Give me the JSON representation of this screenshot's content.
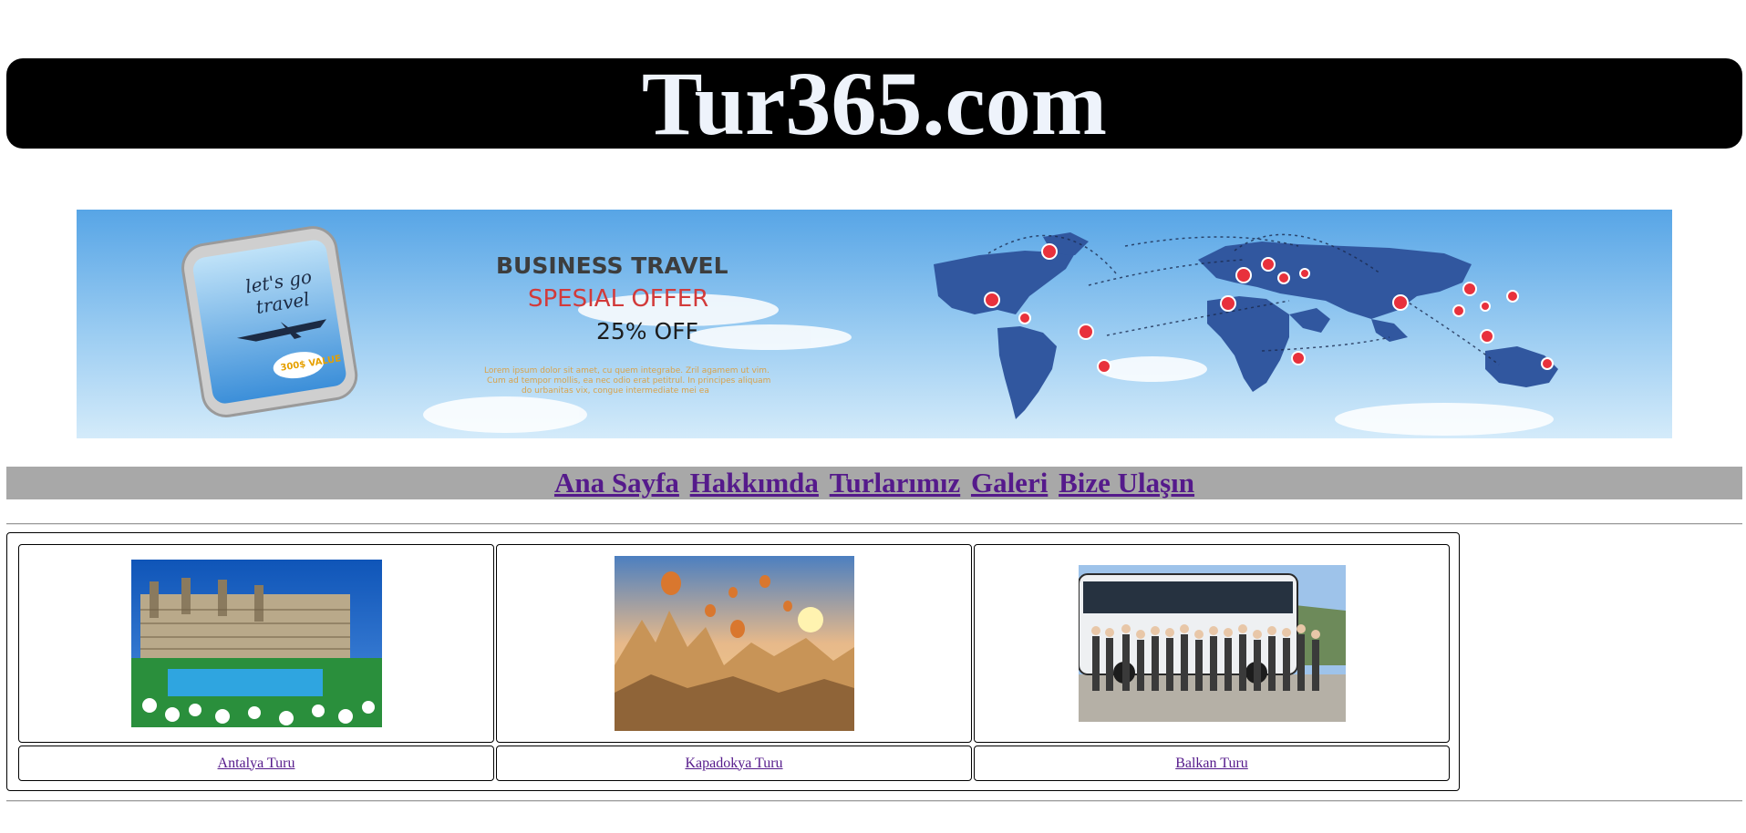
{
  "site": {
    "title": "Tur365.com"
  },
  "banner": {
    "phone_text_line1": "let's go",
    "phone_text_line2": "travel",
    "phone_badge": "300$ VALUE",
    "heading": "BUSINESS TRAVEL",
    "subheading": "SPESIAL OFFER",
    "discount": "25% OFF",
    "body_line1": "Lorem ipsum dolor sit amet, cu quem integrabe. Zril agamem ut vim.",
    "body_line2": "Cum ad tempor mollis, ea nec odio erat petitrul. In principes aliquam",
    "body_line3": "do urbanitas vix, congue intermediate mei ea",
    "colors": {
      "sky": "#5aa9e8",
      "map": "#31579f",
      "pin": "#e8313c"
    }
  },
  "nav": {
    "items": [
      "Ana Sayfa",
      "Hakkımda",
      "Turlarımız",
      "Galeri",
      "Bize Ulaşın"
    ]
  },
  "tours": [
    {
      "name": "Antalya Turu",
      "image": "hotel-resort-photo"
    },
    {
      "name": "Kapadokya Turu",
      "image": "balloons-cappadocia-photo"
    },
    {
      "name": "Balkan Turu",
      "image": "group-bus-photo"
    }
  ]
}
